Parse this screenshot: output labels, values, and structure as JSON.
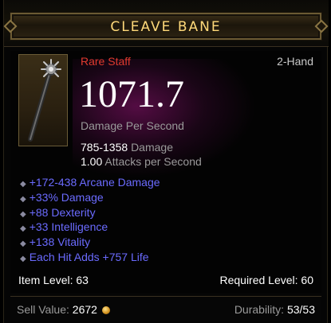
{
  "item": {
    "name": "CLEAVE BANE",
    "rarity_type": "Rare Staff",
    "slot": "2-Hand",
    "dps": "1071.7",
    "dps_label": "Damage Per Second",
    "damage_range": "785-1358",
    "damage_label": "Damage",
    "attack_speed": "1.00",
    "attack_speed_label": "Attacks per Second",
    "affixes": [
      "+172-438 Arcane Damage",
      "+33% Damage",
      "+88 Dexterity",
      "+33 Intelligence",
      "+138 Vitality",
      "Each Hit Adds +757 Life"
    ],
    "item_level_label": "Item Level:",
    "item_level": "63",
    "required_level_label": "Required Level:",
    "required_level": "60",
    "sell_label": "Sell Value:",
    "sell_value": "2672",
    "durability_label": "Durability:",
    "durability": "53/53",
    "icon": "staff-icon"
  },
  "colors": {
    "title": "#ffd97a",
    "rare": "#e03a2f",
    "affix": "#6b6bff",
    "gold": "#d08f1c"
  }
}
